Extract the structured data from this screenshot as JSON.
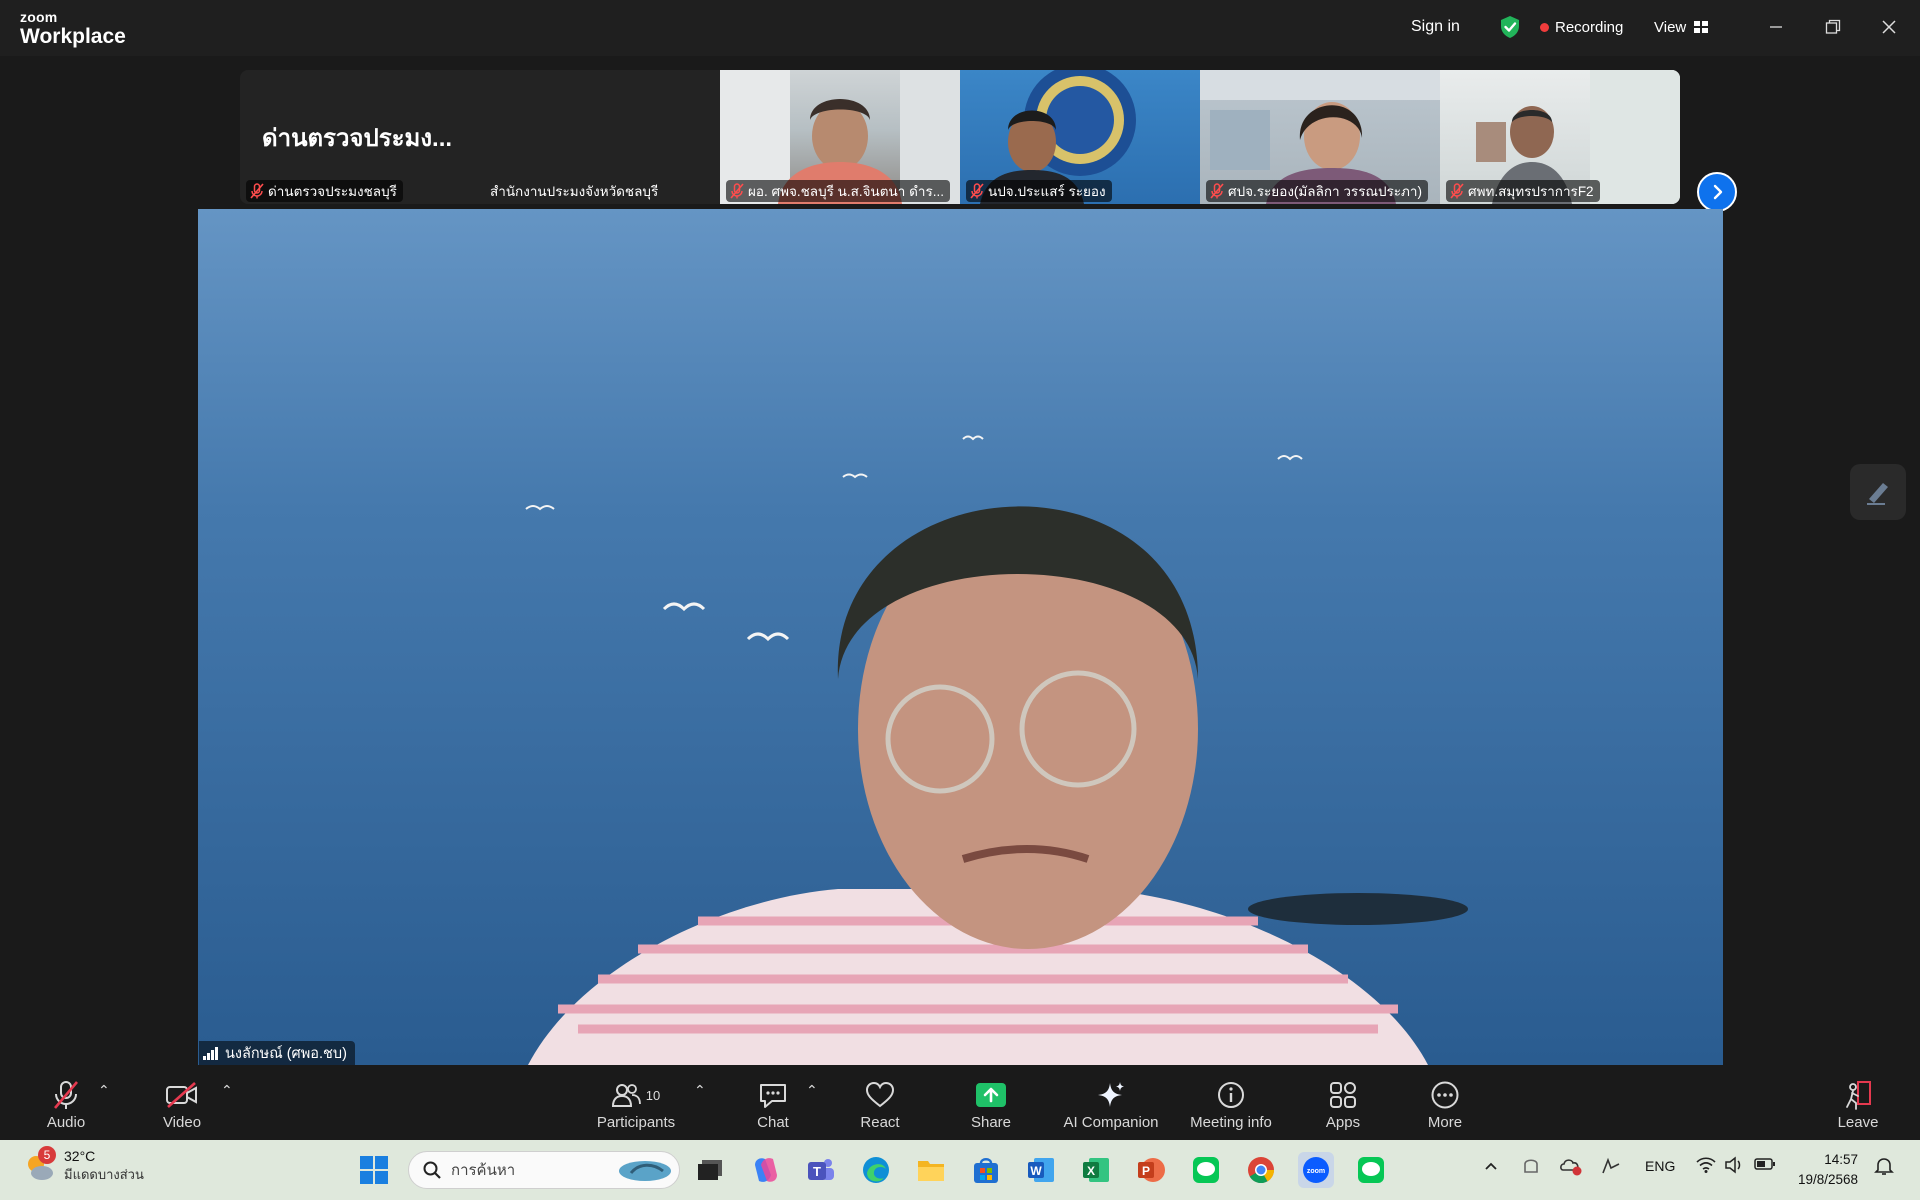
{
  "titlebar": {
    "brand_small": "zoom",
    "brand_big": "Workplace",
    "sign_in": "Sign in",
    "recording": "Recording",
    "view": "View",
    "accent": "#0e72ed",
    "recording_color": "#f03c3c"
  },
  "gallery": {
    "first_tile_title": "ด่านตรวจประมง...",
    "tiles": [
      {
        "label": "ด่านตรวจประมงชลบุรี",
        "muted": true
      },
      {
        "label": "สำนักงานประมงจังหวัดชลบุรี",
        "muted": false
      },
      {
        "label": "ผอ. ศพจ.ชลบุรี น.ส.จินตนา  ดำร...",
        "muted": true
      },
      {
        "label": "นปจ.ประแสร์ ระยอง",
        "muted": true
      },
      {
        "label": "ศปจ.ระยอง(มัลลิกา วรรณประภา)",
        "muted": true
      },
      {
        "label": "ศพท.สมุทรปราการF2",
        "muted": true
      }
    ]
  },
  "speaker": {
    "name": "นงลักษณ์ (ศพอ.ชบ)"
  },
  "toolbar": {
    "audio": "Audio",
    "video": "Video",
    "participants": "Participants",
    "participants_count": "10",
    "chat": "Chat",
    "react": "React",
    "share": "Share",
    "ai_companion": "AI Companion",
    "meeting_info": "Meeting info",
    "apps": "Apps",
    "more": "More",
    "leave": "Leave",
    "share_color": "#1fc168"
  },
  "taskbar": {
    "weather_badge": "5",
    "temperature": "32°C",
    "weather_condition": "มีแดดบางส่วน",
    "search_placeholder": "การค้นหา",
    "language": "ENG",
    "time": "14:57",
    "date": "19/8/2568"
  }
}
